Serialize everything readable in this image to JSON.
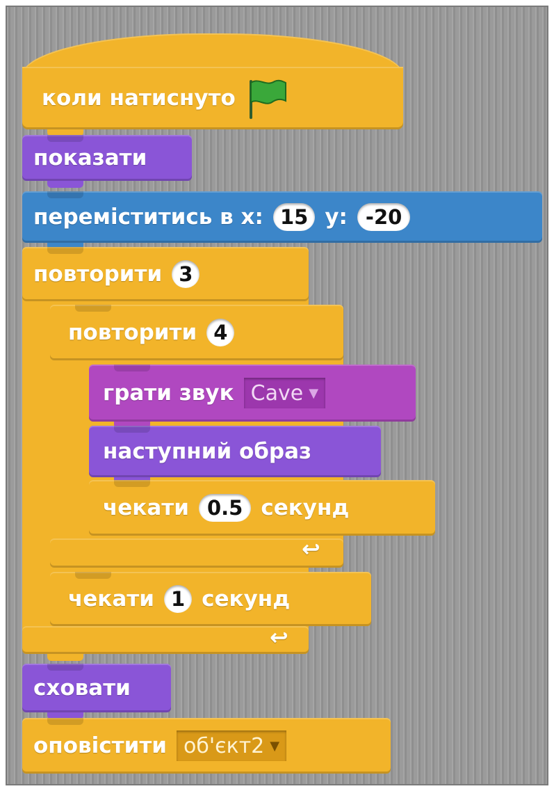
{
  "script": {
    "hat": {
      "label": "коли натиснуто",
      "flag_icon": "green-flag-icon",
      "flag_color": "#3aa83a"
    },
    "show": {
      "label": "показати"
    },
    "goto": {
      "label_x": "переміститись в x:",
      "x": "15",
      "label_y": "y:",
      "y": "-20"
    },
    "repeat_outer": {
      "label": "повторити",
      "count": "3"
    },
    "repeat_inner": {
      "label": "повторити",
      "count": "4"
    },
    "play_sound": {
      "label": "грати звук",
      "sound": "Cave"
    },
    "next_costume": {
      "label": "наступний образ"
    },
    "wait_inner": {
      "label": "чекати",
      "value": "0.5",
      "unit": "секунд"
    },
    "wait_outer": {
      "label": "чекати",
      "value": "1",
      "unit": "секунд"
    },
    "hide": {
      "label": "сховати"
    },
    "broadcast": {
      "label": "оповістити",
      "message": "об'єкт2"
    }
  },
  "colors": {
    "control": "#f2b42a",
    "looks": "#8a55d7",
    "motion": "#3c86c9",
    "sound": "#b048c0",
    "canvas": "#9b9b9b"
  }
}
